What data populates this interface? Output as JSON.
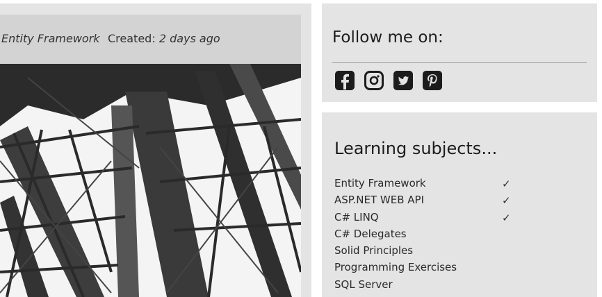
{
  "post": {
    "category": "Entity Framework",
    "created_label": "Created:",
    "created_value": "2 days ago"
  },
  "follow": {
    "title": "Follow me on:",
    "icons": [
      "facebook-icon",
      "instagram-icon",
      "twitter-icon",
      "pinterest-icon"
    ]
  },
  "subjects": {
    "title": "Learning subjects...",
    "items": [
      {
        "label": "Entity Framework",
        "check": "✓"
      },
      {
        "label": "ASP.NET WEB API",
        "check": "✓"
      },
      {
        "label": "C# LINQ",
        "check": "✓"
      },
      {
        "label": "C# Delegates",
        "check": ""
      },
      {
        "label": "Solid Principles",
        "check": ""
      },
      {
        "label": "Programming Exercises",
        "check": ""
      },
      {
        "label": "SQL Server",
        "check": ""
      }
    ]
  }
}
